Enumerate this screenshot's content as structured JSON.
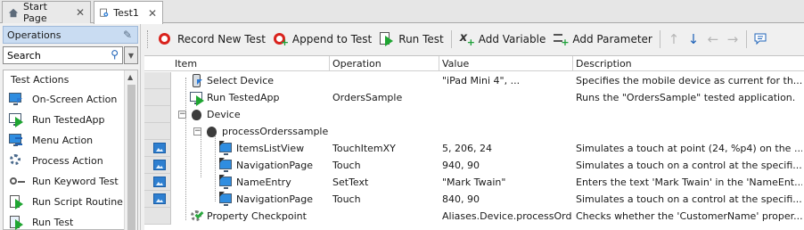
{
  "tabs": [
    {
      "label": "Start Page",
      "icon": "home-icon"
    },
    {
      "label": "Test1",
      "icon": "test-icon",
      "active": true
    }
  ],
  "operations_panel": {
    "title": "Operations",
    "search_value": "Search",
    "group": "Test Actions",
    "items": [
      {
        "label": "On-Screen Action",
        "icon": "on-screen-action-icon"
      },
      {
        "label": "Run TestedApp",
        "icon": "run-testedapp-icon"
      },
      {
        "label": "Menu Action",
        "icon": "menu-action-icon"
      },
      {
        "label": "Process Action",
        "icon": "process-action-icon"
      },
      {
        "label": "Run Keyword Test",
        "icon": "run-keyword-test-icon"
      },
      {
        "label": "Run Script Routine",
        "icon": "run-script-routine-icon"
      },
      {
        "label": "Run Test",
        "icon": "run-test-icon"
      }
    ]
  },
  "toolbar": {
    "record_new_test": "Record New Test",
    "append_to_test": "Append to Test",
    "run_test": "Run Test",
    "add_variable": "Add Variable",
    "add_parameter": "Add Parameter"
  },
  "grid": {
    "columns": [
      "Item",
      "Operation",
      "Value",
      "Description"
    ],
    "rows": [
      {
        "item": "Select Device",
        "operation": "",
        "value": "\"iPad Mini 4\", ...",
        "description": "Specifies the mobile device as current for th...",
        "icon": "select-device-icon",
        "thumb": false
      },
      {
        "item": "Run TestedApp",
        "operation": "OrdersSample",
        "value": "",
        "description": "Runs the \"OrdersSample\" tested application.",
        "icon": "run-testedapp-icon",
        "thumb": false
      },
      {
        "item": "Device",
        "operation": "",
        "value": "",
        "description": "",
        "icon": "apple-icon",
        "thumb": false
      },
      {
        "item": "processOrderssample",
        "operation": "",
        "value": "",
        "description": "",
        "icon": "apple-icon",
        "thumb": false
      },
      {
        "item": "ItemsListView",
        "operation": "TouchItemXY",
        "value": "5, 206, 24",
        "description": "Simulates a touch at point (24, %p4) on the ...",
        "icon": "touch-icon",
        "thumb": true
      },
      {
        "item": "NavigationPage",
        "operation": "Touch",
        "value": "940, 90",
        "description": "Simulates a touch on a control at the specifi...",
        "icon": "touch-icon",
        "thumb": true
      },
      {
        "item": "NameEntry",
        "operation": "SetText",
        "value": "\"Mark Twain\"",
        "description": "Enters the text 'Mark Twain' in the 'NameEnt...",
        "icon": "touch-icon",
        "thumb": true
      },
      {
        "item": "NavigationPage",
        "operation": "Touch",
        "value": "840, 90",
        "description": "Simulates a touch on a control at the specifi...",
        "icon": "touch-icon",
        "thumb": true
      },
      {
        "item": "Property Checkpoint",
        "operation": "",
        "value": "Aliases.Device.processOrd...",
        "description": "Checks whether the 'CustomerName' proper...",
        "icon": "checkpoint-icon",
        "thumb": false
      }
    ]
  }
}
